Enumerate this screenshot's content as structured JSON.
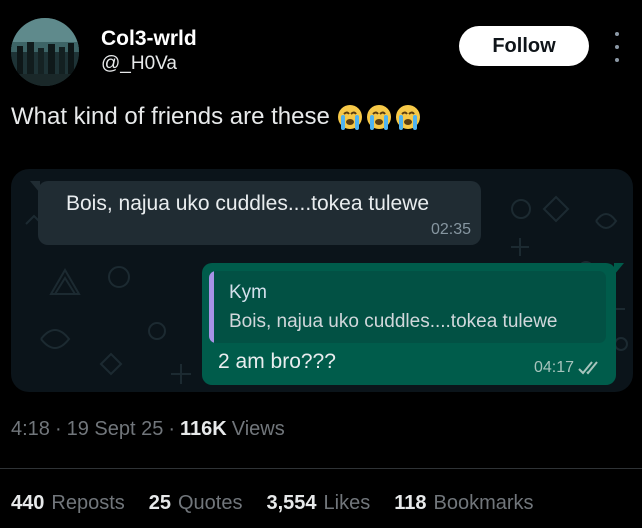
{
  "author": {
    "display_name": "Col3-wrld",
    "handle": "@_H0Va"
  },
  "follow_label": "Follow",
  "post": {
    "text": "What kind of friends are these",
    "emoji": [
      "loudly-crying-face-icon",
      "loudly-crying-face-icon",
      "loudly-crying-face-icon"
    ]
  },
  "chat": {
    "incoming": {
      "text": "Bois, najua uko cuddles....tokea tulewe",
      "time": "02:35"
    },
    "outgoing": {
      "quoted_name": "Kym",
      "quoted_text": "Bois, najua uko cuddles....tokea tulewe",
      "text": "2  am bro???",
      "time": "04:17",
      "status_icon": "double-check-icon"
    },
    "colors": {
      "background": "#0b141a",
      "incoming_bubble": "#202c33",
      "outgoing_bubble": "#005c4b",
      "quote_bar": "#a792e6"
    }
  },
  "meta": {
    "time": "4:18",
    "date": "19 Sept 25",
    "views_count": "116K",
    "views_label": "Views"
  },
  "stats": {
    "reposts_count": "440",
    "reposts_label": "Reposts",
    "quotes_count": "25",
    "quotes_label": "Quotes",
    "likes_count": "3,554",
    "likes_label": "Likes",
    "bookmarks_count": "118",
    "bookmarks_label": "Bookmarks"
  }
}
